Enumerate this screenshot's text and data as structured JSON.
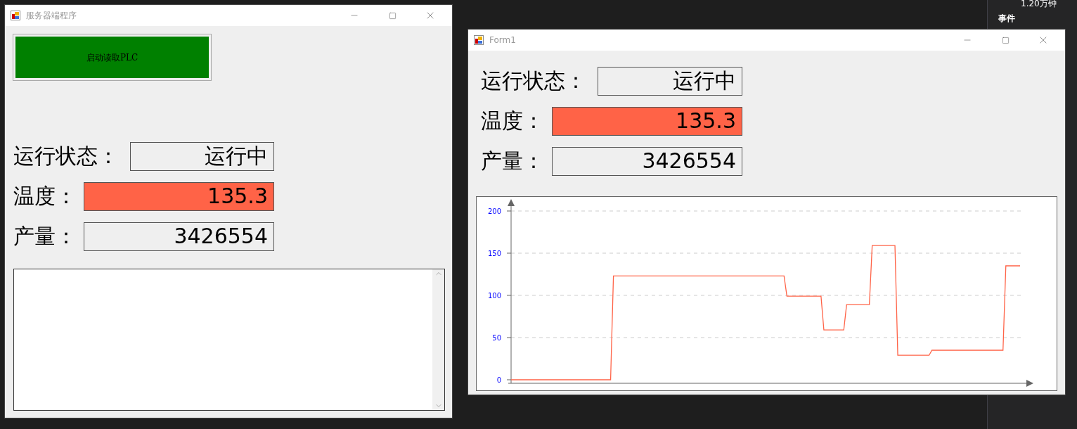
{
  "background": {
    "texts": [
      "1.20万钟",
      "事件"
    ]
  },
  "server_window": {
    "title": "服务器端程序",
    "button": {
      "label": "启动读取PLC",
      "color": "#008000"
    },
    "fields": [
      {
        "label": "运行状态：",
        "value": "运行中",
        "color": "#efefef"
      },
      {
        "label": "温度：",
        "value": "135.3",
        "color": "#ff6347"
      },
      {
        "label": "产量：",
        "value": "3426554",
        "color": "#efefef"
      }
    ]
  },
  "form_window": {
    "title": "Form1",
    "fields": [
      {
        "label": "运行状态：",
        "value": "运行中",
        "color": "#efefef"
      },
      {
        "label": "温度：",
        "value": "135.3",
        "color": "#ff6347"
      },
      {
        "label": "产量：",
        "value": "3426554",
        "color": "#efefef"
      }
    ],
    "chart_data": {
      "type": "line",
      "categories": [
        null,
        null,
        null,
        null,
        null,
        null,
        null,
        null,
        null,
        null,
        null,
        null,
        null,
        null,
        null,
        null,
        null,
        null,
        null,
        null,
        null,
        null,
        null,
        null,
        null,
        null,
        null,
        null,
        null,
        null,
        null,
        null,
        null,
        null,
        null,
        null,
        null,
        null,
        null,
        null,
        null,
        null,
        null,
        null,
        null,
        null,
        null,
        null,
        null,
        null,
        null,
        null,
        null,
        null,
        null,
        null,
        null,
        null,
        null,
        null,
        null,
        null,
        null,
        null,
        null,
        null,
        null,
        null,
        null,
        null,
        null,
        null,
        null,
        null,
        null,
        null,
        null,
        null,
        null,
        null,
        null,
        null,
        null,
        null,
        null,
        null,
        null,
        null,
        null,
        null,
        null,
        null,
        null,
        null,
        null,
        null,
        null,
        null,
        null,
        null,
        null,
        null,
        null,
        null,
        null,
        null,
        null,
        null,
        null,
        null,
        null,
        null,
        null,
        null,
        null,
        null,
        null,
        null,
        null,
        null,
        null,
        null,
        null,
        null,
        null,
        null,
        null,
        null,
        null,
        null,
        null,
        null,
        null,
        null,
        null,
        null,
        null,
        null,
        null,
        null,
        null,
        null,
        null,
        null,
        null,
        null,
        null,
        null,
        null,
        null,
        null,
        null,
        null,
        null,
        null,
        null,
        null,
        null,
        null,
        null,
        null,
        null,
        null,
        null,
        null,
        null,
        null,
        null,
        null,
        null,
        null,
        null,
        null,
        null,
        null,
        null,
        null,
        null,
        null,
        null
      ],
      "ylim": [
        -4.167,
        200
      ],
      "grid": true,
      "yticks": [
        0,
        50,
        100,
        150,
        200
      ],
      "series": [
        {
          "color": "#ff6347",
          "values": [
            0,
            0,
            0,
            0,
            0,
            0,
            0,
            0,
            0,
            0,
            0,
            0,
            0,
            0,
            0,
            0,
            0,
            0,
            0,
            0,
            0,
            0,
            0,
            0,
            0,
            0,
            0,
            0,
            0,
            0,
            0,
            0,
            0,
            0,
            0,
            0,
            123,
            123,
            123,
            123,
            123,
            123,
            123,
            123,
            123,
            123,
            123,
            123,
            123,
            123,
            123,
            123,
            123,
            123,
            123,
            123,
            123,
            123,
            123,
            123,
            123,
            123,
            123,
            123,
            123,
            123,
            123,
            123,
            123,
            123,
            123,
            123,
            123,
            123,
            123,
            123,
            123,
            123,
            123,
            123,
            123,
            123,
            123,
            123,
            123,
            123,
            123,
            123,
            123,
            123,
            123,
            123,
            123,
            123,
            123,
            123,
            123,
            99,
            99,
            99,
            99,
            99,
            99,
            99,
            99,
            99,
            99,
            99,
            99,
            99,
            59,
            59,
            59,
            59,
            59,
            59,
            59,
            59,
            89,
            89,
            89,
            89,
            89,
            89,
            89,
            89,
            89,
            159,
            159,
            159,
            159,
            159,
            159,
            159,
            159,
            159,
            29,
            29,
            29,
            29,
            29,
            29,
            29,
            29,
            29,
            29,
            29,
            29,
            35,
            35,
            35,
            35,
            35,
            35,
            35,
            35,
            35,
            35,
            35,
            35,
            35,
            35,
            35,
            35,
            35,
            35,
            35,
            35,
            35,
            35,
            35,
            35,
            35,
            35,
            135,
            135,
            135,
            135,
            135,
            135
          ]
        }
      ]
    }
  }
}
